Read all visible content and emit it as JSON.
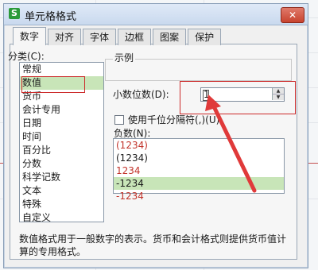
{
  "window": {
    "title": "单元格格式",
    "app_icon": "S",
    "close": "✕"
  },
  "tabs": [
    {
      "label": "数字",
      "active": true
    },
    {
      "label": "对齐",
      "active": false
    },
    {
      "label": "字体",
      "active": false
    },
    {
      "label": "边框",
      "active": false
    },
    {
      "label": "图案",
      "active": false
    },
    {
      "label": "保护",
      "active": false
    }
  ],
  "category": {
    "label": "分类(C):",
    "items": [
      "常规",
      "数值",
      "货币",
      "会计专用",
      "日期",
      "时间",
      "百分比",
      "分数",
      "科学记数",
      "文本",
      "特殊",
      "自定义"
    ],
    "selected": "数值"
  },
  "sample": {
    "label": "示例"
  },
  "decimals": {
    "label": "小数位数(D):",
    "value": "1"
  },
  "thousands": {
    "label": "使用千位分隔符(,)(U)",
    "checked": false
  },
  "negative": {
    "label": "负数(N):",
    "items": [
      {
        "text": "(1234)",
        "red": true,
        "selected": false
      },
      {
        "text": "(1234)",
        "red": false,
        "selected": false
      },
      {
        "text": "1234",
        "red": true,
        "selected": false
      },
      {
        "text": "-1234",
        "red": false,
        "selected": true
      },
      {
        "text": "-1234",
        "red": true,
        "selected": false
      }
    ]
  },
  "description": "数值格式用于一般数字的表示。货币和会计格式则提供货币值计算的专用格式。",
  "colors": {
    "highlight": "#cc2a2a",
    "selection": "#c8e5b8",
    "negative_red": "#c2332a"
  }
}
